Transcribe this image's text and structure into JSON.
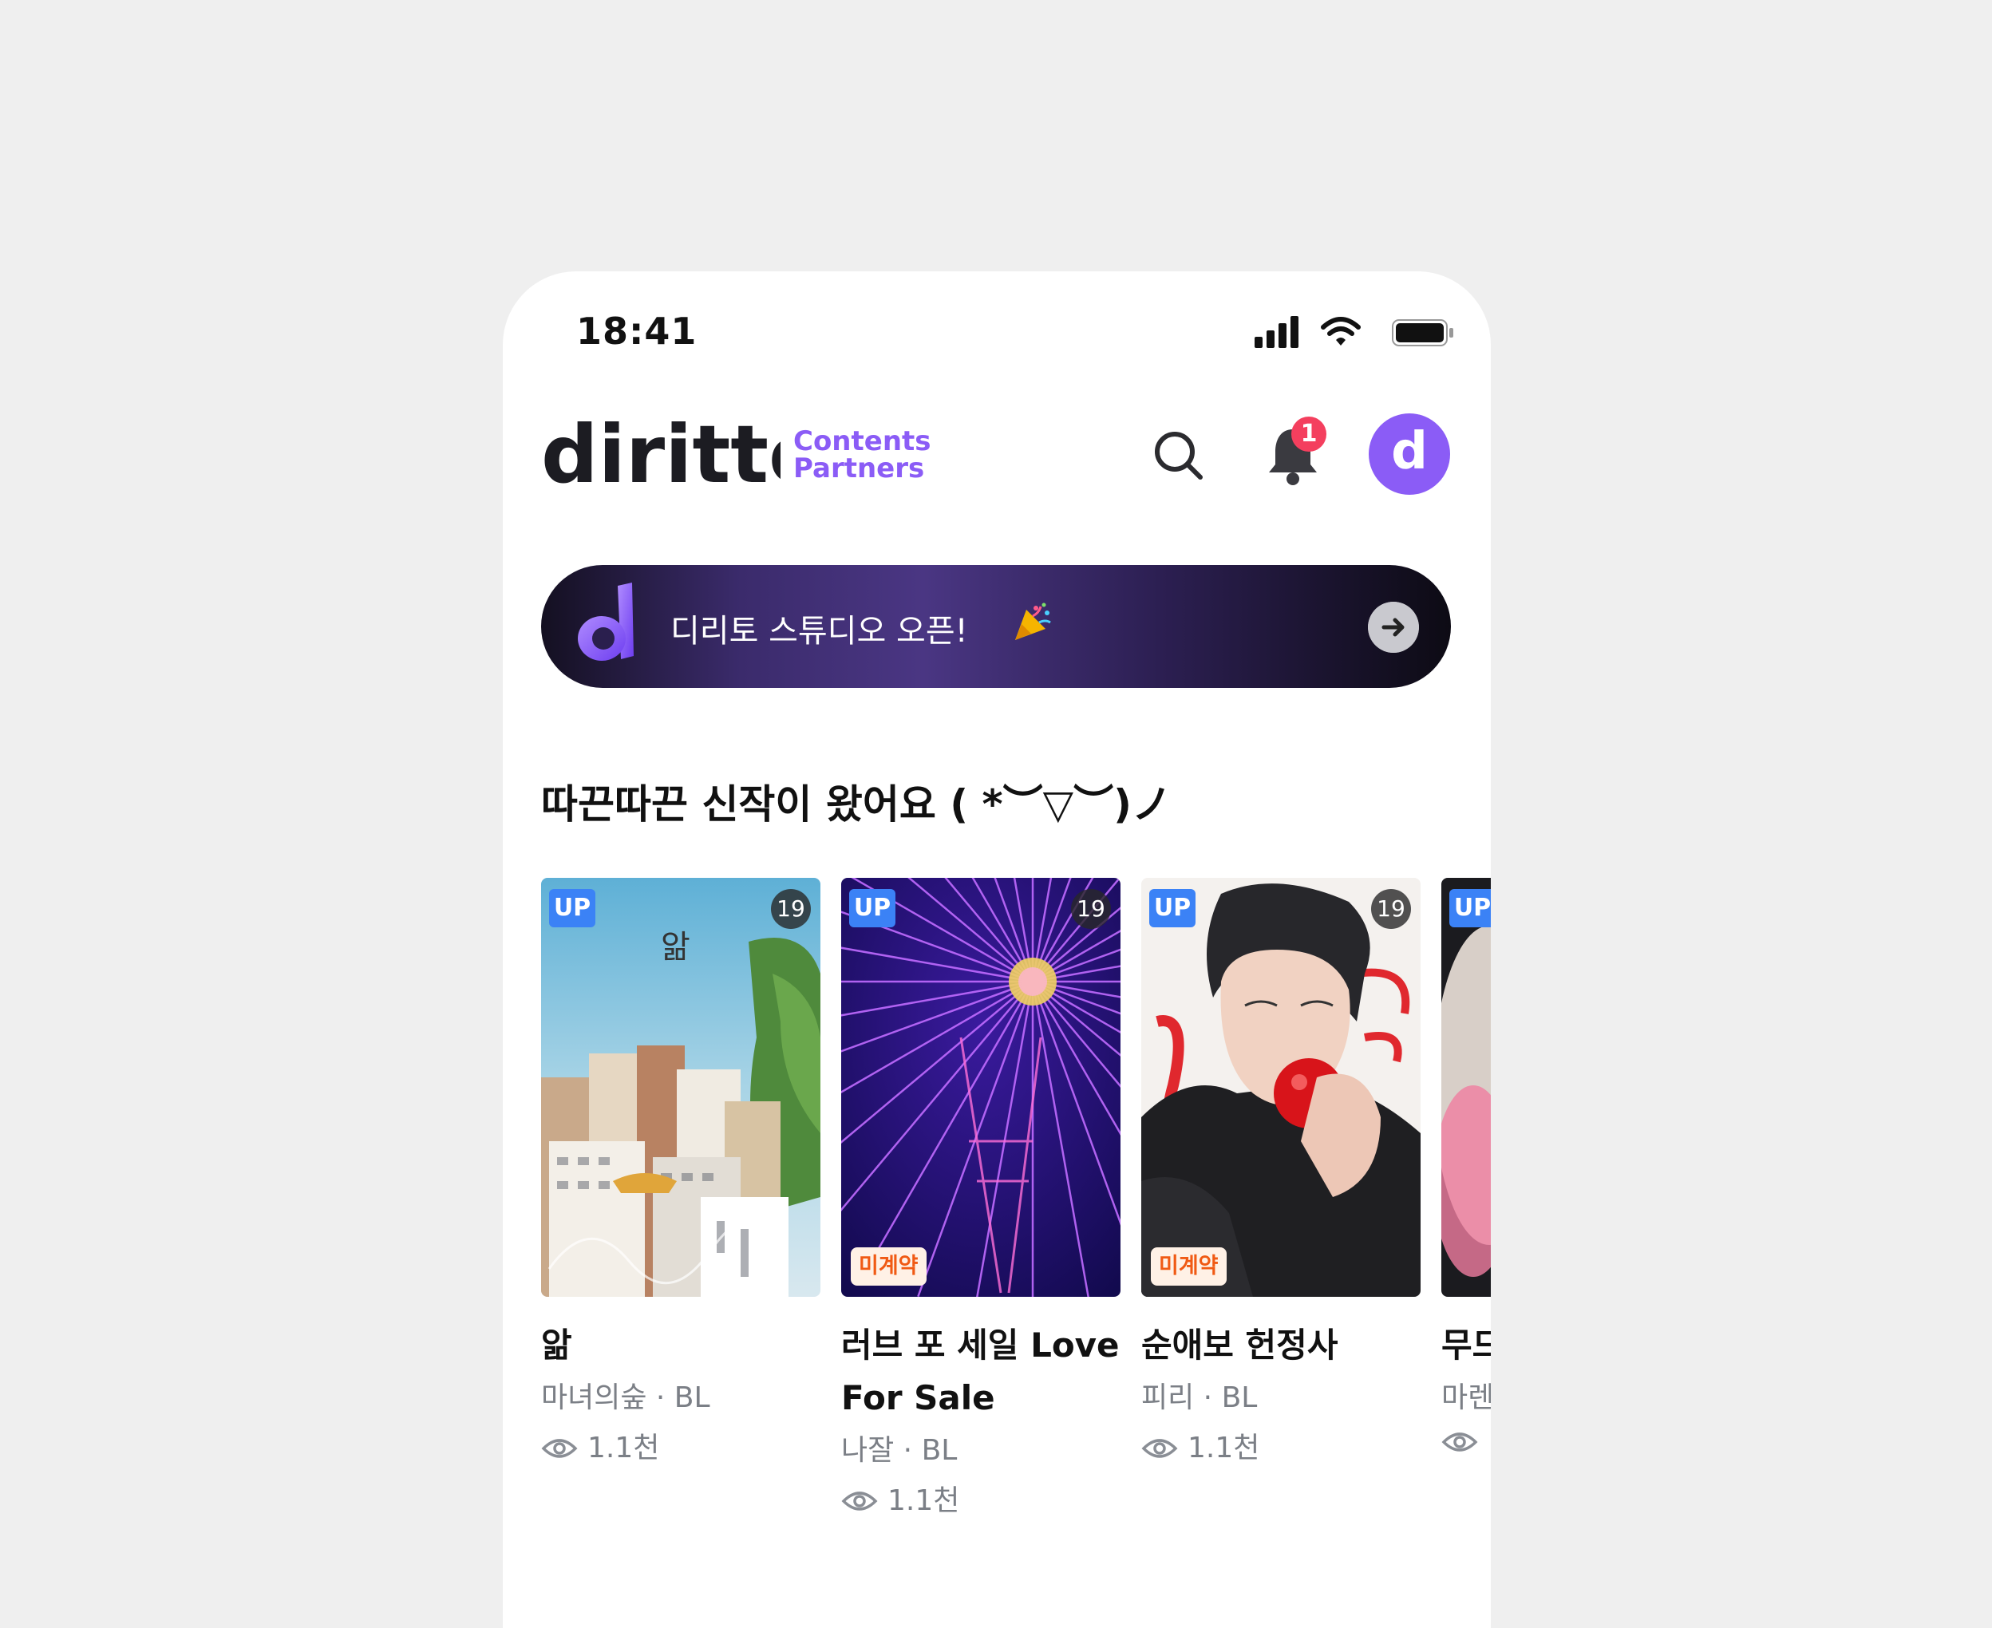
{
  "status_bar": {
    "time": "18:41"
  },
  "header": {
    "logo_text": "diritto",
    "logo_sub_line1": "Contents",
    "logo_sub_line2": "Partners",
    "notification_count": "1",
    "avatar_letter": "d"
  },
  "banner": {
    "text": "디리토 스튜디오 오픈!"
  },
  "section": {
    "title": "따끈따끈 신작이 왔어요 ( *︶▽︶)ノ"
  },
  "cards": [
    {
      "title": "앎",
      "author_genre": "마녀의숲 · BL",
      "views": "1.1천",
      "badge_up": "UP",
      "badge_age": "19",
      "badge_contract": ""
    },
    {
      "title": "러브 포 세일 Love For Sale",
      "author_genre": "나잘 · BL",
      "views": "1.1천",
      "badge_up": "UP",
      "badge_age": "19",
      "badge_contract": "미계약"
    },
    {
      "title": "순애보 헌정사",
      "author_genre": "피리 · BL",
      "views": "1.1천",
      "badge_up": "UP",
      "badge_age": "19",
      "badge_contract": "미계약"
    },
    {
      "title": "무드 Mo",
      "author_genre": "마렌",
      "views": "",
      "badge_up": "UP",
      "badge_age": "",
      "badge_contract": ""
    }
  ],
  "colors": {
    "accent": "#8b5cf6",
    "up_badge": "#3b82f6",
    "notification": "#f43f5e",
    "contract": "#f05a14"
  },
  "icons": [
    "signal-icon",
    "wifi-icon",
    "battery-icon",
    "search-icon",
    "bell-icon",
    "arrow-right-icon",
    "eye-icon",
    "party-popper-icon"
  ]
}
